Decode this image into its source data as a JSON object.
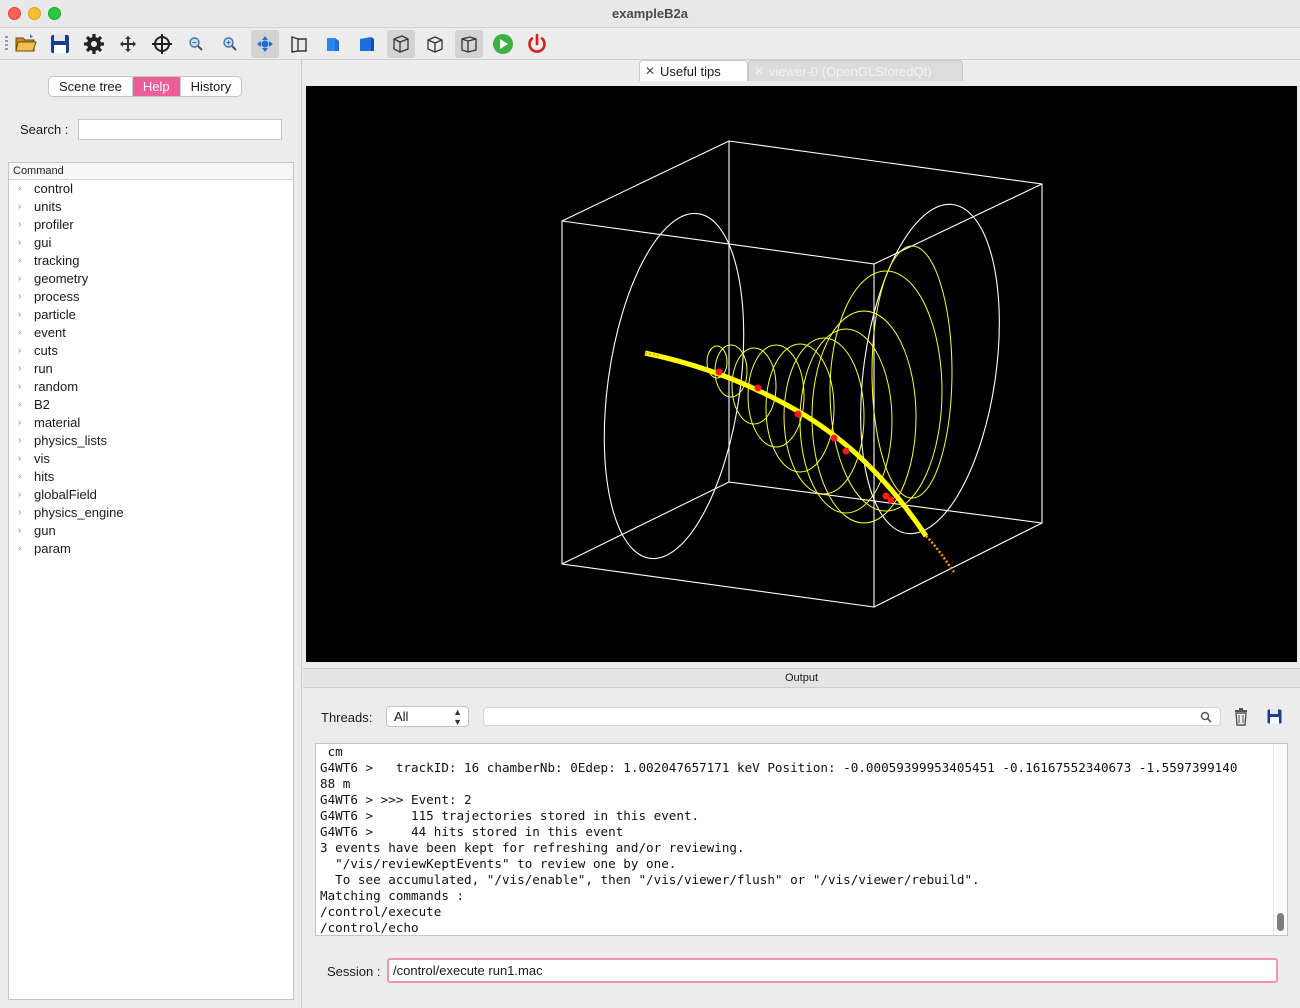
{
  "window": {
    "title": "exampleB2a"
  },
  "toolbar": {
    "buttons": [
      "open-icon",
      "save-icon",
      "settings-icon",
      "move-icon",
      "pick-target-icon",
      "zoom-out-icon",
      "zoom-in-icon",
      "rotate-icon",
      "perspective-icon",
      "ortho-blue-icon",
      "solid-blue-icon",
      "wireframe-box-icon",
      "hidden-line-icon",
      "hidden-surface-icon",
      "run-icon",
      "power-icon"
    ],
    "colors": {
      "accent_blue": "#1e6fd9",
      "run_green": "#3cb043",
      "power_red": "#d81e1e"
    }
  },
  "left_panel": {
    "tabs": [
      "Scene tree",
      "Help",
      "History"
    ],
    "active_tab": "Help",
    "search_label": "Search :",
    "search_value": "",
    "tree_header": "Command",
    "commands": [
      "control",
      "units",
      "profiler",
      "gui",
      "tracking",
      "geometry",
      "process",
      "particle",
      "event",
      "cuts",
      "run",
      "random",
      "B2",
      "material",
      "physics_lists",
      "vis",
      "hits",
      "globalField",
      "physics_engine",
      "gun",
      "param"
    ]
  },
  "viewer_tabs": [
    {
      "label": "Useful tips",
      "active": true
    },
    {
      "label": "viewer-0 (OpenGLStoredQt)",
      "active": false
    }
  ],
  "scene": {
    "background": "#000000",
    "geometry_color": "#ffffff",
    "chamber_color": "#ffff00",
    "track_color": "#ffff00",
    "hit_color": "#ff0000"
  },
  "output": {
    "title": "Output",
    "threads_label": "Threads:",
    "threads_value": "All",
    "filter_value": "",
    "lines": [
      " cm",
      "G4WT6 >   trackID: 16 chamberNb: 0Edep: 1.002047657171 keV Position: -0.00059399953405451 -0.16167552340673 -1.5597399140",
      "88 m",
      "G4WT6 > >>> Event: 2",
      "G4WT6 >     115 trajectories stored in this event.",
      "G4WT6 >     44 hits stored in this event",
      "3 events have been kept for refreshing and/or reviewing.",
      "  \"/vis/reviewKeptEvents\" to review one by one.",
      "  To see accumulated, \"/vis/enable\", then \"/vis/viewer/flush\" or \"/vis/viewer/rebuild\".",
      "Matching commands :",
      "/control/execute",
      "/control/echo"
    ],
    "session_label": "Session :",
    "session_value": "/control/execute run1.mac"
  }
}
